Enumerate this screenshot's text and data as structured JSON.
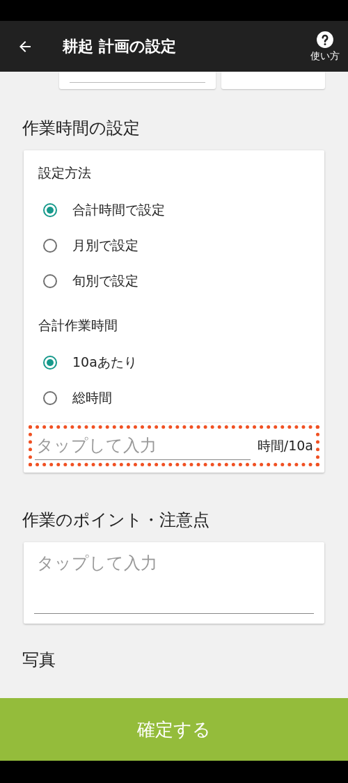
{
  "header": {
    "title": "耕起 計画の設定",
    "help_label": "使い方"
  },
  "work_time": {
    "title": "作業時間の設定",
    "method_label": "設定方法",
    "methods": [
      {
        "label": "合計時間で設定",
        "selected": true
      },
      {
        "label": "月別で設定",
        "selected": false
      },
      {
        "label": "旬別で設定",
        "selected": false
      }
    ],
    "total_label": "合計作業時間",
    "units": [
      {
        "label": "10aあたり",
        "selected": true
      },
      {
        "label": "総時間",
        "selected": false
      }
    ],
    "input": {
      "placeholder": "タップして入力",
      "unit": "時間/10a",
      "highlighted": true
    }
  },
  "points": {
    "title": "作業のポイント・注意点",
    "placeholder": "タップして入力"
  },
  "photo": {
    "title": "写真"
  },
  "confirm_button": "確定する"
}
